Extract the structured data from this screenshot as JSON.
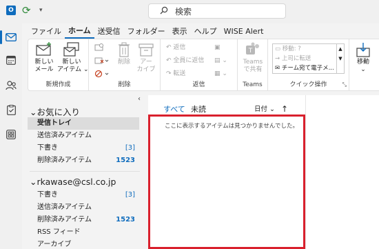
{
  "titlebar": {
    "app_icon_text": "O",
    "search_placeholder": "検索"
  },
  "rail": {
    "items": [
      {
        "icon": "mail-icon"
      },
      {
        "icon": "calendar-icon"
      },
      {
        "icon": "people-icon"
      },
      {
        "icon": "tasks-icon"
      },
      {
        "icon": "apps-icon"
      }
    ]
  },
  "ribbon_tabs": [
    "ファイル",
    "ホーム",
    "送受信",
    "フォルダー",
    "表示",
    "ヘルプ",
    "WISE Alert"
  ],
  "ribbon": {
    "new_mail": "新しい\nメール",
    "new_items": "新しい\nアイテム ⌄",
    "group_new": "新規作成",
    "delete": "削除",
    "archive": "アー\nカイブ",
    "group_delete": "削除",
    "reply": "返信",
    "reply_all": "全員に返信",
    "forward": "転送",
    "group_reply": "返信",
    "teams_share": "Teams\nで共有",
    "group_teams": "Teams",
    "quick_steps": [
      "移動: ?",
      "上司に転送",
      "チーム宛て電子メ..."
    ],
    "group_quick": "クイック操作",
    "move": "移動\n⌄"
  },
  "folders": {
    "favorites_header": "お気に入り",
    "favorites": [
      {
        "name": "受信トレイ",
        "count": "",
        "selected": true
      },
      {
        "name": "送信済みアイテム",
        "count": ""
      },
      {
        "name": "下書き",
        "count": "[3]"
      },
      {
        "name": "削除済みアイテム",
        "count": "1523",
        "bold": true
      }
    ],
    "account_header": "rkawase@csl.co.jp",
    "account_folders": [
      {
        "name": "下書き",
        "count": "[3]"
      },
      {
        "name": "送信済みアイテム",
        "count": ""
      },
      {
        "name": "削除済みアイテム",
        "count": "1523",
        "bold": true
      },
      {
        "name": "RSS フィード",
        "count": ""
      },
      {
        "name": "アーカイブ",
        "count": ""
      }
    ]
  },
  "message_list": {
    "tab_all": "すべて",
    "tab_unread": "未読",
    "sort_label": "日付 ⌄",
    "sort_arrow": "↑",
    "empty_text": "ここに表示するアイテムは見つかりませんでした。"
  },
  "colors": {
    "accent": "#0f6cbd",
    "highlight_border": "#d9202d"
  }
}
